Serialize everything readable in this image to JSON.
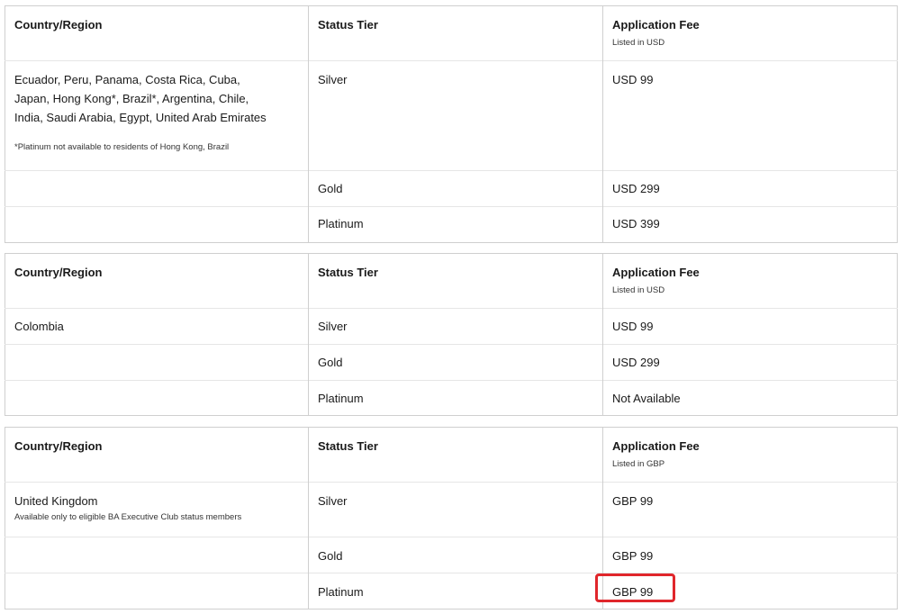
{
  "tables": [
    {
      "header": {
        "country_col": "Country/Region",
        "tier_col": "Status Tier",
        "fee_col": "Application Fee",
        "fee_sub": "Listed in USD"
      },
      "country_lines": [
        "Ecuador, Peru, Panama, Costa Rica, Cuba,",
        "Japan, Hong Kong*, Brazil*, Argentina, Chile,",
        "India, Saudi Arabia, Egypt, United Arab Emirates"
      ],
      "country_note": "*Platinum not available to residents of Hong Kong, Brazil",
      "rows": [
        {
          "tier": "Silver",
          "fee": "USD 99"
        },
        {
          "tier": "Gold",
          "fee": "USD 299"
        },
        {
          "tier": "Platinum",
          "fee": "USD 399"
        }
      ]
    },
    {
      "header": {
        "country_col": "Country/Region",
        "tier_col": "Status Tier",
        "fee_col": "Application Fee",
        "fee_sub": "Listed in USD"
      },
      "country_lines": [
        "Colombia"
      ],
      "country_note": "",
      "rows": [
        {
          "tier": "Silver",
          "fee": "USD 99"
        },
        {
          "tier": "Gold",
          "fee": "USD 299"
        },
        {
          "tier": "Platinum",
          "fee": "Not Available"
        }
      ]
    },
    {
      "header": {
        "country_col": "Country/Region",
        "tier_col": "Status Tier",
        "fee_col": "Application Fee",
        "fee_sub": "Listed in GBP"
      },
      "country_lines": [
        "United Kingdom"
      ],
      "country_note": "Available only to eligible BA Executive Club status members",
      "rows": [
        {
          "tier": "Silver",
          "fee": "GBP 99"
        },
        {
          "tier": "Gold",
          "fee": "GBP 99"
        },
        {
          "tier": "Platinum",
          "fee": "GBP 99"
        }
      ]
    }
  ],
  "highlight_color": "#e0262b"
}
